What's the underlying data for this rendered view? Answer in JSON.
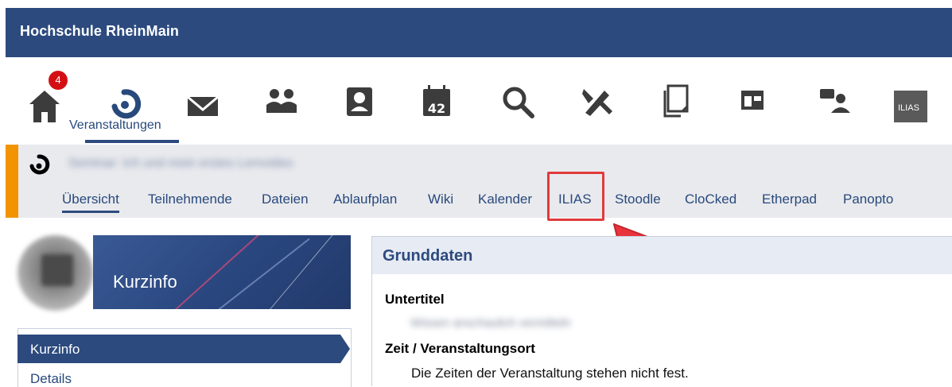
{
  "header": {
    "brand": "Hochschule RheinMain"
  },
  "nav": {
    "badge_count": "4",
    "active_label": "Veranstaltungen",
    "items": [
      {
        "icon": "home-icon"
      },
      {
        "icon": "courses-icon"
      },
      {
        "icon": "mail-icon"
      },
      {
        "icon": "community-icon"
      },
      {
        "icon": "profile-icon"
      },
      {
        "icon": "calendar-icon"
      },
      {
        "icon": "search-icon"
      },
      {
        "icon": "tools-icon"
      },
      {
        "icon": "documents-icon"
      },
      {
        "icon": "dashboard-icon"
      },
      {
        "icon": "chat-icon"
      },
      {
        "icon": "ilias-icon",
        "text": "ILIAS"
      }
    ]
  },
  "course": {
    "title": "Seminar: Ich und mein erstes Lernvideo",
    "tabs": [
      "Übersicht",
      "Teilnehmende",
      "Dateien",
      "Ablaufplan",
      "Wiki",
      "Kalender",
      "ILIAS",
      "Stoodle",
      "CloCked",
      "Etherpad",
      "Panopto"
    ],
    "active_tab": "Übersicht",
    "highlighted_tab": "ILIAS"
  },
  "sidebar": {
    "card_title": "Kurzinfo",
    "items": [
      "Kurzinfo",
      "Details"
    ],
    "active": "Kurzinfo"
  },
  "main": {
    "section_title": "Grunddaten",
    "fields": [
      {
        "label": "Untertitel",
        "value": "Wissen anschaulich vermitteln"
      },
      {
        "label": "Zeit / Veranstaltungsort",
        "value": "Die Zeiten der Veranstaltung stehen nicht fest."
      }
    ]
  },
  "colors": {
    "brand_blue": "#2c4a7e",
    "accent_orange": "#f29400",
    "badge_red": "#d40f14",
    "annotation_red": "#e03b3b"
  }
}
